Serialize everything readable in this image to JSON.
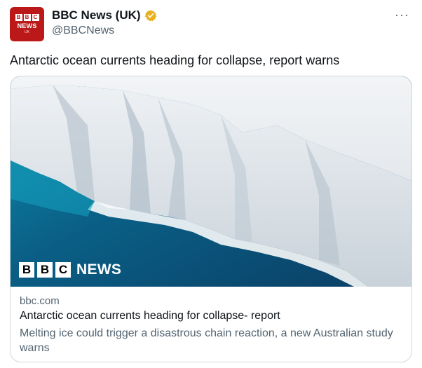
{
  "account": {
    "avatar_logo_letters": [
      "B",
      "B",
      "C"
    ],
    "avatar_logo_word": "NEWS",
    "avatar_logo_sub": "UK",
    "display_name": "BBC News (UK)",
    "handle": "@BBCNews",
    "verified_icon": "verified-badge-icon",
    "verified_color": "#e8b21e",
    "brand_color": "#bb1919"
  },
  "more_label": "···",
  "tweet_text": "Antarctic ocean currents heading for collapse, report warns",
  "card": {
    "image_logo_letters": [
      "B",
      "B",
      "C"
    ],
    "image_logo_word": "NEWS",
    "domain": "bbc.com",
    "title": "Antarctic ocean currents heading for collapse- report",
    "description": "Melting ice could trigger a disastrous chain reaction, a new Australian study warns"
  }
}
